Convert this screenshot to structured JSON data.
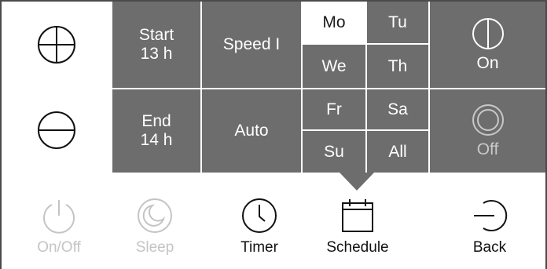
{
  "timer": {
    "start_label": "Start",
    "start_value": "13 h",
    "end_label": "End",
    "end_value": "14 h",
    "speed_label": "Speed I",
    "mode_label": "Auto"
  },
  "days": {
    "mo": "Mo",
    "tu": "Tu",
    "we": "We",
    "th": "Th",
    "fr": "Fr",
    "sa": "Sa",
    "su": "Su",
    "all": "All"
  },
  "power_panel": {
    "on_label": "On",
    "off_label": "Off"
  },
  "bottom_bar": {
    "onoff": "On/Off",
    "sleep": "Sleep",
    "timer": "Timer",
    "schedule": "Schedule",
    "back": "Back"
  },
  "colors": {
    "panel": "#6d6d6d",
    "disabled": "#c4c4c4",
    "text": "#111111"
  }
}
